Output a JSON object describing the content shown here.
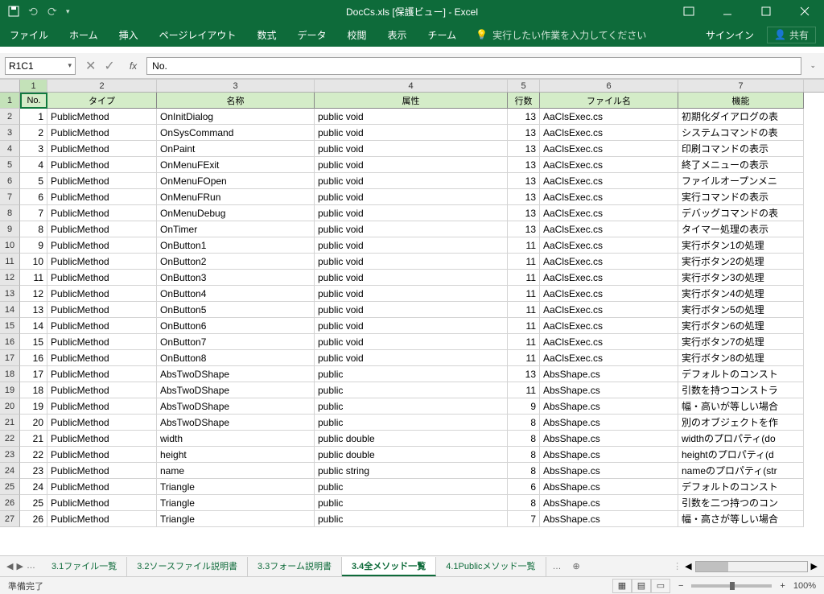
{
  "title": "DocCs.xls [保護ビュー] - Excel",
  "qat": {
    "save": "save-icon",
    "undo": "undo-icon",
    "redo": "redo-icon"
  },
  "ribbon": {
    "tabs": [
      "ファイル",
      "ホーム",
      "挿入",
      "ページレイアウト",
      "数式",
      "データ",
      "校閲",
      "表示",
      "チーム"
    ],
    "tellme": "実行したい作業を入力してください",
    "signin": "サインイン",
    "share": "共有"
  },
  "namebox": "R1C1",
  "formula": "No.",
  "col_headers": [
    "1",
    "2",
    "3",
    "4",
    "5",
    "6",
    "7"
  ],
  "table_headers": [
    "No.",
    "タイプ",
    "名称",
    "属性",
    "行数",
    "ファイル名",
    "機能"
  ],
  "rows": [
    {
      "r": "2",
      "no": "1",
      "type": "PublicMethod",
      "name": "OnInitDialog",
      "attr": "public void",
      "lines": "13",
      "file": "AaClsExec.cs",
      "fn": "初期化ダイアログの表"
    },
    {
      "r": "3",
      "no": "2",
      "type": "PublicMethod",
      "name": "OnSysCommand",
      "attr": "public void",
      "lines": "13",
      "file": "AaClsExec.cs",
      "fn": "システムコマンドの表"
    },
    {
      "r": "4",
      "no": "3",
      "type": "PublicMethod",
      "name": "OnPaint",
      "attr": "public void",
      "lines": "13",
      "file": "AaClsExec.cs",
      "fn": "印刷コマンドの表示"
    },
    {
      "r": "5",
      "no": "4",
      "type": "PublicMethod",
      "name": "OnMenuFExit",
      "attr": "public void",
      "lines": "13",
      "file": "AaClsExec.cs",
      "fn": "終了メニューの表示"
    },
    {
      "r": "6",
      "no": "5",
      "type": "PublicMethod",
      "name": "OnMenuFOpen",
      "attr": "public void",
      "lines": "13",
      "file": "AaClsExec.cs",
      "fn": "ファイルオープンメニ"
    },
    {
      "r": "7",
      "no": "6",
      "type": "PublicMethod",
      "name": "OnMenuFRun",
      "attr": "public void",
      "lines": "13",
      "file": "AaClsExec.cs",
      "fn": "実行コマンドの表示"
    },
    {
      "r": "8",
      "no": "7",
      "type": "PublicMethod",
      "name": "OnMenuDebug",
      "attr": "public void",
      "lines": "13",
      "file": "AaClsExec.cs",
      "fn": "デバッグコマンドの表"
    },
    {
      "r": "9",
      "no": "8",
      "type": "PublicMethod",
      "name": "OnTimer",
      "attr": "public void",
      "lines": "13",
      "file": "AaClsExec.cs",
      "fn": "タイマー処理の表示"
    },
    {
      "r": "10",
      "no": "9",
      "type": "PublicMethod",
      "name": "OnButton1",
      "attr": "public void",
      "lines": "11",
      "file": "AaClsExec.cs",
      "fn": "実行ボタン1の処理"
    },
    {
      "r": "11",
      "no": "10",
      "type": "PublicMethod",
      "name": "OnButton2",
      "attr": "public void",
      "lines": "11",
      "file": "AaClsExec.cs",
      "fn": "実行ボタン2の処理"
    },
    {
      "r": "12",
      "no": "11",
      "type": "PublicMethod",
      "name": "OnButton3",
      "attr": "public void",
      "lines": "11",
      "file": "AaClsExec.cs",
      "fn": "実行ボタン3の処理"
    },
    {
      "r": "13",
      "no": "12",
      "type": "PublicMethod",
      "name": "OnButton4",
      "attr": "public void",
      "lines": "11",
      "file": "AaClsExec.cs",
      "fn": "実行ボタン4の処理"
    },
    {
      "r": "14",
      "no": "13",
      "type": "PublicMethod",
      "name": "OnButton5",
      "attr": "public void",
      "lines": "11",
      "file": "AaClsExec.cs",
      "fn": "実行ボタン5の処理"
    },
    {
      "r": "15",
      "no": "14",
      "type": "PublicMethod",
      "name": "OnButton6",
      "attr": "public void",
      "lines": "11",
      "file": "AaClsExec.cs",
      "fn": "実行ボタン6の処理"
    },
    {
      "r": "16",
      "no": "15",
      "type": "PublicMethod",
      "name": "OnButton7",
      "attr": "public void",
      "lines": "11",
      "file": "AaClsExec.cs",
      "fn": "実行ボタン7の処理"
    },
    {
      "r": "17",
      "no": "16",
      "type": "PublicMethod",
      "name": "OnButton8",
      "attr": "public void",
      "lines": "11",
      "file": "AaClsExec.cs",
      "fn": "実行ボタン8の処理"
    },
    {
      "r": "18",
      "no": "17",
      "type": "PublicMethod",
      "name": "AbsTwoDShape",
      "attr": "public",
      "lines": "13",
      "file": "AbsShape.cs",
      "fn": "デフォルトのコンスト"
    },
    {
      "r": "19",
      "no": "18",
      "type": "PublicMethod",
      "name": "AbsTwoDShape",
      "attr": "public",
      "lines": "11",
      "file": "AbsShape.cs",
      "fn": "引数を持つコンストラ"
    },
    {
      "r": "20",
      "no": "19",
      "type": "PublicMethod",
      "name": "AbsTwoDShape",
      "attr": "public",
      "lines": "9",
      "file": "AbsShape.cs",
      "fn": "幅・高いが等しい場合"
    },
    {
      "r": "21",
      "no": "20",
      "type": "PublicMethod",
      "name": "AbsTwoDShape",
      "attr": "public",
      "lines": "8",
      "file": "AbsShape.cs",
      "fn": "別のオブジェクトを作"
    },
    {
      "r": "22",
      "no": "21",
      "type": "PublicMethod",
      "name": "width",
      "attr": "public double",
      "lines": "8",
      "file": "AbsShape.cs",
      "fn": "widthのプロパティ(do"
    },
    {
      "r": "23",
      "no": "22",
      "type": "PublicMethod",
      "name": "height",
      "attr": "public double",
      "lines": "8",
      "file": "AbsShape.cs",
      "fn": "heightのプロパティ(d"
    },
    {
      "r": "24",
      "no": "23",
      "type": "PublicMethod",
      "name": "name",
      "attr": "public string",
      "lines": "8",
      "file": "AbsShape.cs",
      "fn": "nameのプロパティ(str"
    },
    {
      "r": "25",
      "no": "24",
      "type": "PublicMethod",
      "name": "Triangle",
      "attr": "public",
      "lines": "6",
      "file": "AbsShape.cs",
      "fn": "デフォルトのコンスト"
    },
    {
      "r": "26",
      "no": "25",
      "type": "PublicMethod",
      "name": "Triangle",
      "attr": "public",
      "lines": "8",
      "file": "AbsShape.cs",
      "fn": "引数を二つ持つのコン"
    },
    {
      "r": "27",
      "no": "26",
      "type": "PublicMethod",
      "name": "Triangle",
      "attr": "public",
      "lines": "7",
      "file": "AbsShape.cs",
      "fn": "幅・高さが等しい場合"
    }
  ],
  "sheets": [
    "3.1ファイル一覧",
    "3.2ソースファイル説明書",
    "3.3フォーム説明書",
    "3.4全メソッド一覧",
    "4.1Publicメソッド一覧"
  ],
  "active_sheet": 3,
  "status": "準備完了",
  "zoom": "100%"
}
